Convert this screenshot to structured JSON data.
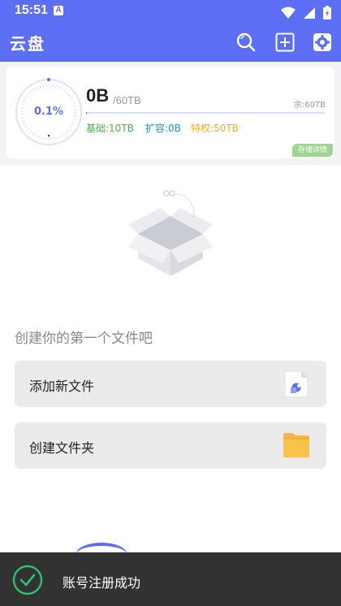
{
  "status_bar": {
    "time": "15:51",
    "notification_badge": "A"
  },
  "app_bar": {
    "title": "云盘",
    "icons": [
      "search-icon",
      "add-icon",
      "settings-icon"
    ]
  },
  "storage": {
    "percent_label": "0.1%",
    "used": "0B",
    "total": "/60TB",
    "remaining": "余:60TB",
    "used_fraction": 0.001,
    "base": "基础:10TB",
    "expansion": "扩容:0B",
    "privilege": "特权:50TB",
    "detail_button": "存储详情"
  },
  "empty_state": {
    "message": "创建你的第一个文件吧"
  },
  "actions": [
    {
      "label": "添加新文件",
      "icon": "file-icon"
    },
    {
      "label": "创建文件夹",
      "icon": "folder-icon"
    }
  ],
  "toast": {
    "message": "账号注册成功"
  },
  "colors": {
    "primary": "#5b6ef4",
    "base": "#4caf50",
    "expansion": "#1f90d4",
    "privilege": "#f2b11c",
    "toast_bg": "#323232",
    "success": "#2fbf71"
  }
}
